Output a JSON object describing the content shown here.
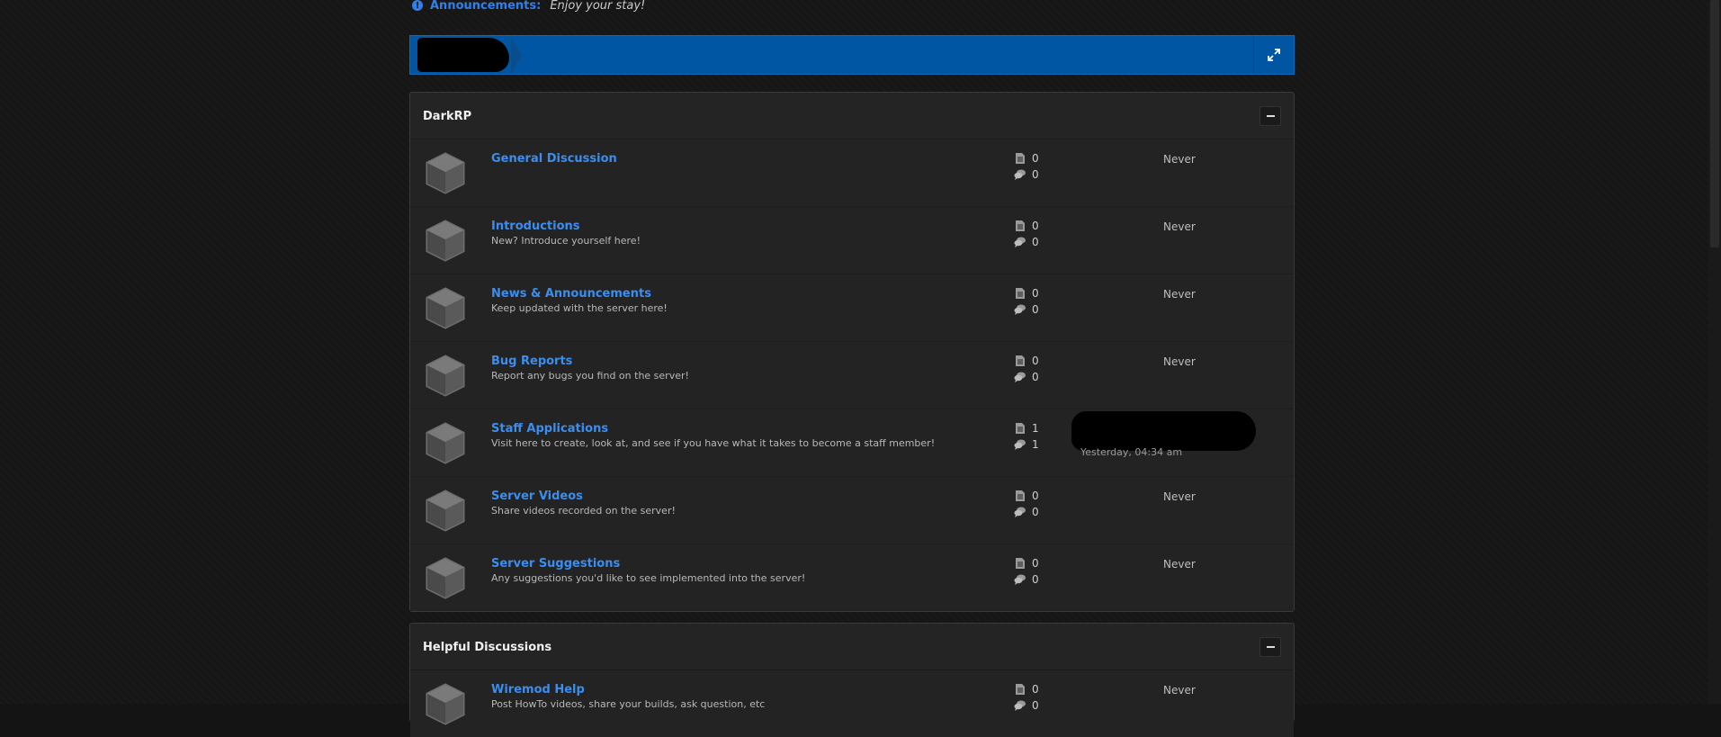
{
  "announcement": {
    "icon": "info-icon",
    "label": "Announcements:",
    "text": "Enjoy your stay!"
  },
  "navbar": {
    "expand_icon": "expand-icon",
    "brand_color": "#0056a3"
  },
  "categories": [
    {
      "title": "DarkRP",
      "boards": [
        {
          "name": "General Discussion",
          "description": "",
          "posts": "0",
          "topics": "0",
          "last_post": "Never",
          "last_time": ""
        },
        {
          "name": "Introductions",
          "description": "New? Introduce yourself here!",
          "posts": "0",
          "topics": "0",
          "last_post": "Never",
          "last_time": ""
        },
        {
          "name": "News & Announcements",
          "description": "Keep updated with the server here!",
          "posts": "0",
          "topics": "0",
          "last_post": "Never",
          "last_time": ""
        },
        {
          "name": "Bug Reports",
          "description": "Report any bugs you find on the server!",
          "posts": "0",
          "topics": "0",
          "last_post": "Never",
          "last_time": ""
        },
        {
          "name": "Staff Applications",
          "description": "Visit here to create, look at, and see if you have what it takes to become a staff member!",
          "posts": "1",
          "topics": "1",
          "last_post": "",
          "last_time": "Yesterday, 04:34 am"
        },
        {
          "name": "Server Videos",
          "description": "Share videos recorded on the server!",
          "posts": "0",
          "topics": "0",
          "last_post": "Never",
          "last_time": ""
        },
        {
          "name": "Server Suggestions",
          "description": "Any suggestions you'd like to see implemented into the server!",
          "posts": "0",
          "topics": "0",
          "last_post": "Never",
          "last_time": ""
        }
      ]
    },
    {
      "title": "Helpful Discussions",
      "boards": [
        {
          "name": "Wiremod Help",
          "description": "Post HowTo videos, share your builds, ask question, etc",
          "posts": "0",
          "topics": "0",
          "last_post": "Never",
          "last_time": ""
        }
      ]
    }
  ]
}
